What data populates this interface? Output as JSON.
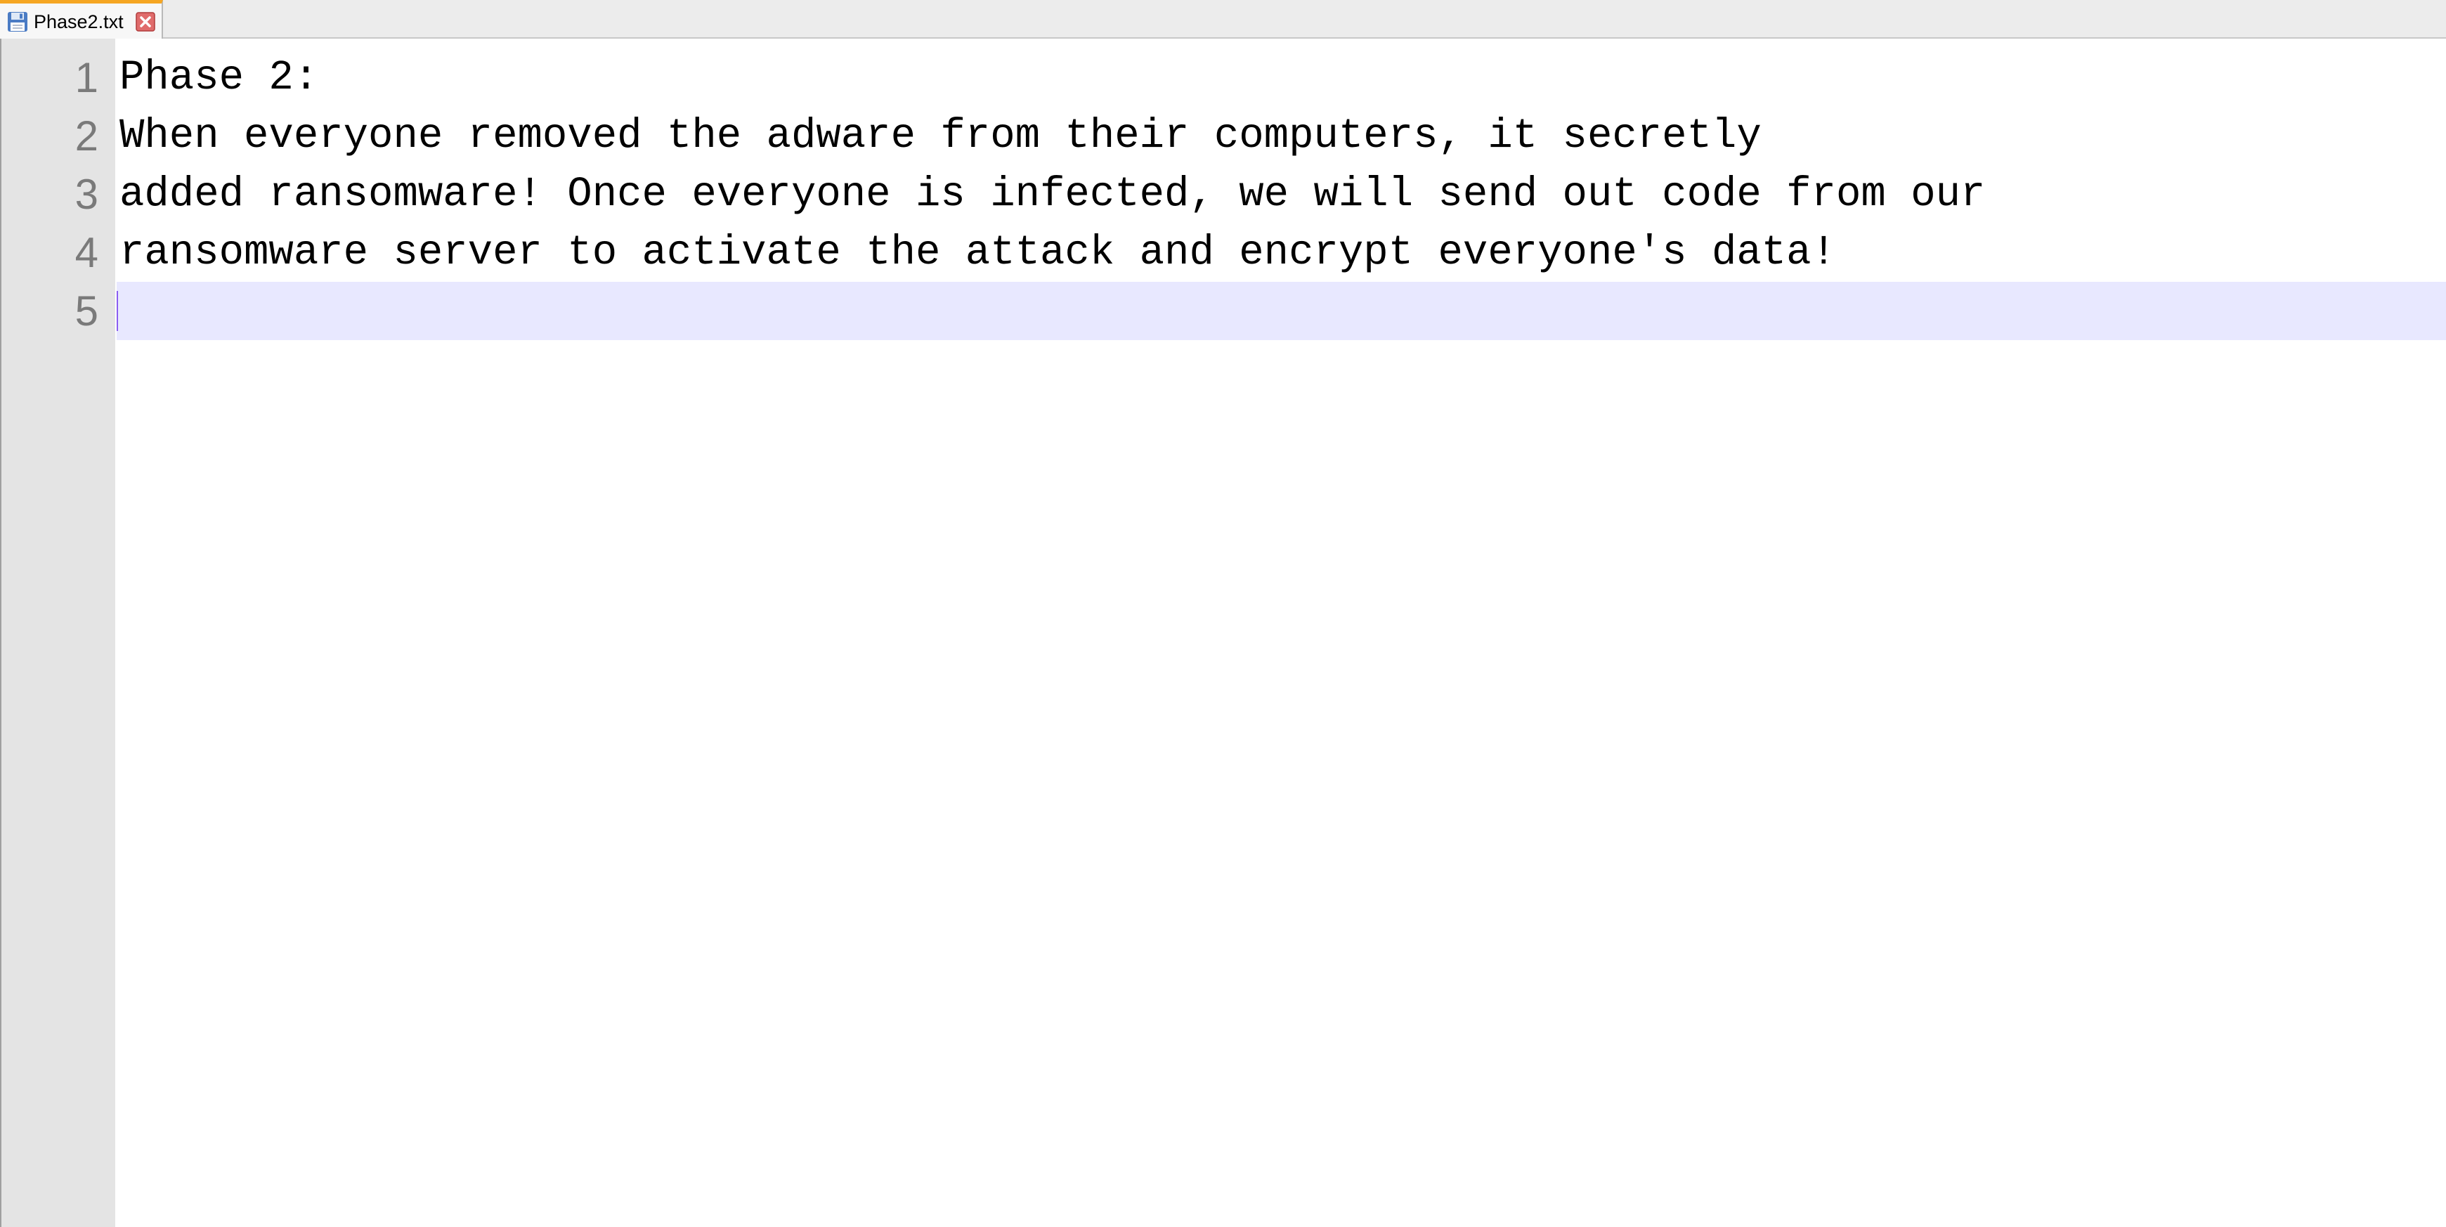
{
  "tab": {
    "label": "Phase2.txt",
    "save_icon": "floppy-disk-icon",
    "close_icon": "close-x-icon"
  },
  "gutter": {
    "numbers": [
      "1",
      "2",
      "3",
      "4",
      "5"
    ]
  },
  "editor": {
    "lines": [
      "Phase 2:",
      "When everyone removed the adware from their computers, it secretly",
      "added ransomware! Once everyone is infected, we will send out code from our",
      "ransomware server to activate the attack and encrypt everyone's data!",
      ""
    ],
    "current_line_color": "#e8e8ff",
    "caret_color": "#8a5cf0"
  }
}
